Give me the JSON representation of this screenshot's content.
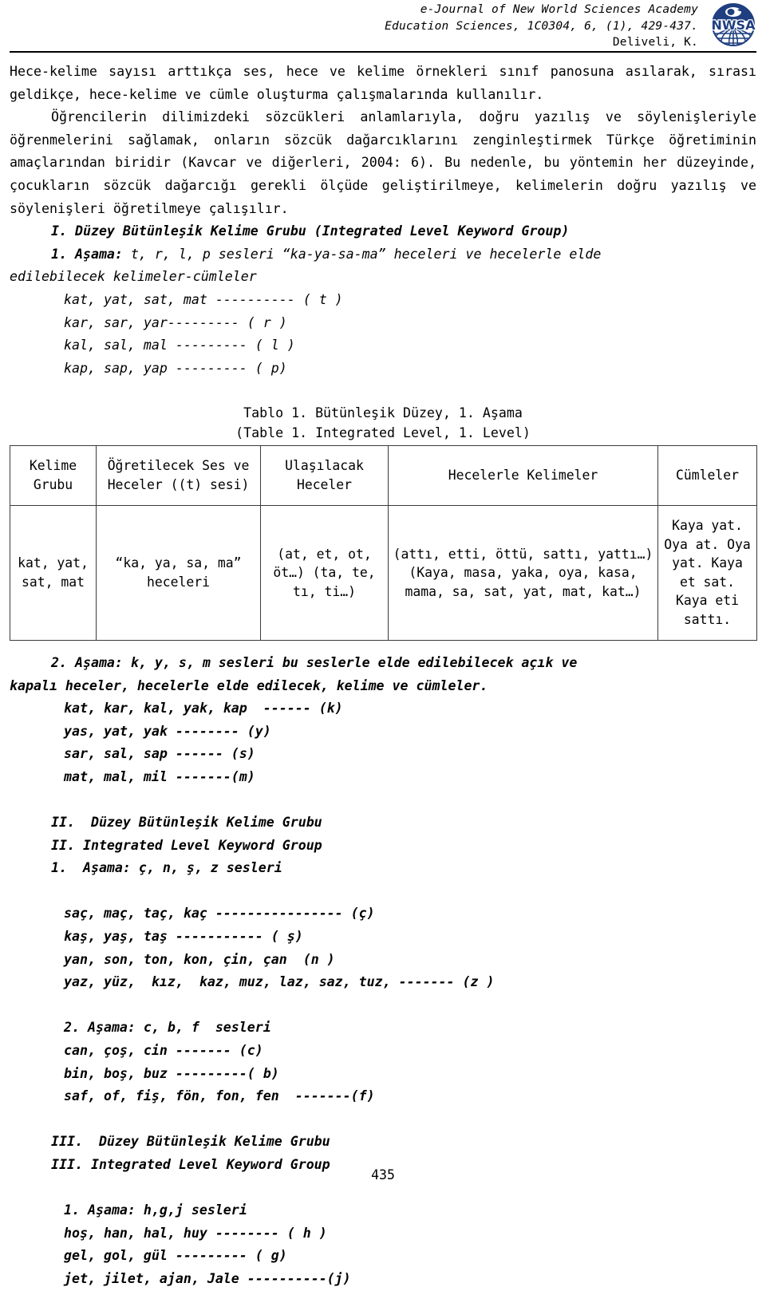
{
  "header": {
    "line1": "e-Journal of New World Sciences Academy",
    "line2": "Education Sciences, 1C0304, 6, (1), 429-437.",
    "line3": "Deliveli, K.",
    "logo_text": "NWSA",
    "logo_color": "#1f3f80"
  },
  "body": {
    "para1": "Hece-kelime sayısı arttıkça ses, hece ve kelime örnekleri sınıf panosuna asılarak, sırası geldikçe, hece-kelime ve cümle oluşturma çalışmalarında kullanılır.",
    "para2": "Öğrencilerin dilimizdeki sözcükleri anlamlarıyla, doğru yazılış ve söylenişleriyle öğrenmelerini sağlamak, onların sözcük dağarcıklarını zenginleştirmek Türkçe öğretiminin amaçlarından biridir (Kavcar ve diğerleri, 2004: 6). Bu nedenle, bu yöntemin her düzeyinde, çocukların sözcük dağarcığı gerekli ölçüde geliştirilmeye, kelimelerin doğru yazılış ve söylenişleri öğretilmeye çalışılır.",
    "group1_heading": "I. Düzey Bütünleşik Kelime Grubu (Integrated Level Keyword Group)",
    "group1_stage1_label": "1. Aşama:",
    "group1_stage1_text": " t, r, l, p sesleri “ka-ya-sa-ma” heceleri ve hecelerle elde",
    "group1_stage1_cont": "edilebilecek kelimeler-cümleler",
    "group1_list": [
      "kat, yat, sat, mat ---------- ( t )",
      "kar, sar, yar--------- ( r )",
      "kal, sal, mal --------- ( l )",
      "kap, sap, yap --------- ( p)"
    ],
    "group1_stage2_label": "2. Aşama:",
    "group1_stage2_text": " k, y, s, m sesleri bu seslerle elde edilebilecek açık ve",
    "group1_stage2_cont": "kapalı heceler, hecelerle elde edilecek, kelime ve cümleler.",
    "group1_stage2_list": [
      "kat, kar, kal, yak, kap  ------ (k)",
      "yas, yat, yak -------- (y)",
      "sar, sal, sap ------ (s)",
      "mat, mal, mil -------(m)"
    ],
    "group2_heading_tr": "II.  Düzey Bütünleşik Kelime Grubu",
    "group2_heading_en": "II. Integrated Level Keyword Group",
    "group2_stage1": "1.  Aşama: ç, n, ş, z sesleri",
    "group2_stage1_list": [
      "saç, maç, taç, kaç ---------------- (ç)",
      "kaş, yaş, taş ----------- ( ş)",
      "yan, son, ton, kon, çin, çan  (n )",
      "yaz, yüz,  kız,  kaz, muz, laz, saz, tuz, ------- (z )"
    ],
    "group2_stage2": "2. Aşama: c, b, f  sesleri",
    "group2_stage2_list": [
      "can, çoş, cin ------- (c)",
      "bin, boş, buz ---------( b)",
      "saf, of, fiş, fön, fon, fen  -------(f)"
    ],
    "group3_heading_tr": "III.  Düzey Bütünleşik Kelime Grubu",
    "group3_heading_en": "III. Integrated Level Keyword Group",
    "group3_stage1": "1. Aşama: h,g,j sesleri",
    "group3_stage1_list": [
      "hoş, han, hal, huy -------- ( h )",
      "gel, gol, gül --------- ( g)",
      "jet, jilet, ajan, Jale ----------(j)"
    ]
  },
  "table": {
    "caption_tr": "Tablo 1. Bütünleşik Düzey, 1. Aşama",
    "caption_en": "(Table 1. Integrated Level, 1. Level)",
    "headers": [
      "Kelime Grubu",
      "Öğretilecek Ses ve Heceler ((t) sesi)",
      "Ulaşılacak Heceler",
      "Hecelerle Kelimeler",
      "Cümleler"
    ],
    "rows": [
      [
        "kat, yat, sat, mat",
        "“ka, ya, sa, ma” heceleri",
        "(at, et, ot, öt…) (ta, te, tı, ti…)",
        "(attı, etti, öttü, sattı, yattı…) (Kaya, masa, yaka, oya, kasa, mama, sa, sat, yat, mat, kat…)",
        "Kaya yat. Oya at. Oya yat. Kaya et sat. Kaya eti sattı."
      ]
    ]
  },
  "footer": {
    "page_number": "435"
  }
}
